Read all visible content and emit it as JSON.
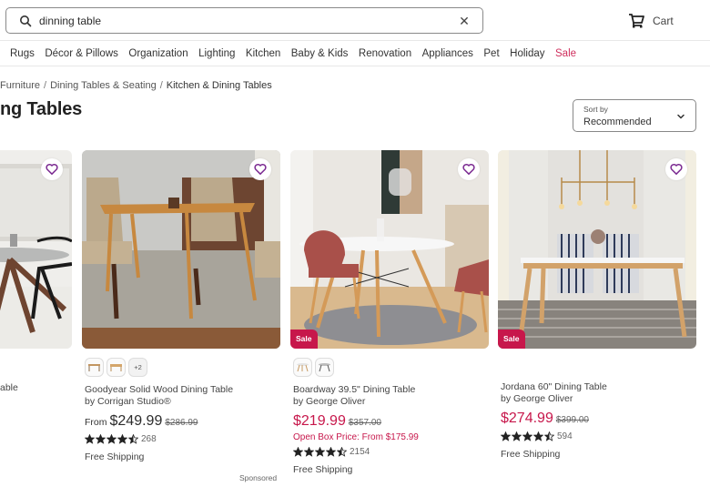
{
  "search": {
    "value": "dinning table",
    "placeholder": "Search"
  },
  "header": {
    "cart_label": "Cart"
  },
  "nav": {
    "items": [
      "Rugs",
      "Décor & Pillows",
      "Organization",
      "Lighting",
      "Kitchen",
      "Baby & Kids",
      "Renovation",
      "Appliances",
      "Pet",
      "Holiday",
      "Sale"
    ]
  },
  "breadcrumb": {
    "items": [
      "Furniture",
      "Dining Tables & Seating"
    ],
    "current": "Kitchen & Dining Tables",
    "separator": "/"
  },
  "page_title": "ng Tables",
  "sort": {
    "label": "Sort by",
    "value": "Recommended"
  },
  "colors": {
    "accent": "#c7174b",
    "heart": "#7b2a91",
    "sale_nav": "#cf2f5d"
  },
  "products": [
    {
      "name_partial": "able"
    },
    {
      "name": "Goodyear Solid Wood Dining Table",
      "brand": "by Corrigan Studio®",
      "price_prefix": "From",
      "price": "$249.99",
      "original_price": "$286.99",
      "rating": 4.5,
      "review_count": "268",
      "shipping": "Free Shipping",
      "swatches_more": "+2",
      "sponsored": "Sponsored"
    },
    {
      "name": "Boardway 39.5\" Dining Table",
      "brand": "by George Oliver",
      "price": "$219.99",
      "original_price": "$357.00",
      "open_box": "Open Box Price: From $175.99",
      "rating": 4.5,
      "review_count": "2154",
      "shipping": "Free Shipping",
      "badge": "Sale"
    },
    {
      "name": "Jordana 60\" Dining Table",
      "brand": "by George Oliver",
      "price": "$274.99",
      "original_price": "$399.00",
      "rating": 4.5,
      "review_count": "594",
      "shipping": "Free Shipping",
      "badge": "Sale"
    }
  ]
}
